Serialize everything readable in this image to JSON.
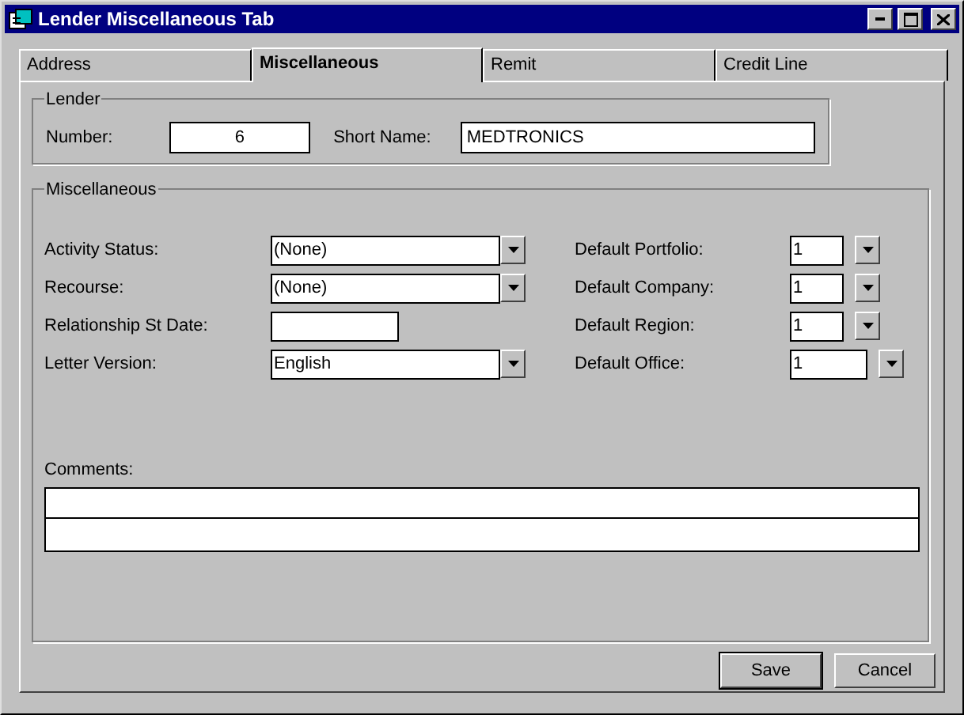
{
  "window": {
    "title": "Lender Miscellaneous Tab"
  },
  "tabs": [
    {
      "label": "Address",
      "selected": false
    },
    {
      "label": "Miscellaneous",
      "selected": true
    },
    {
      "label": "Remit",
      "selected": false
    },
    {
      "label": "Credit Line",
      "selected": false
    }
  ],
  "lender": {
    "title": "Lender",
    "number": {
      "label": "Number:",
      "value": "6"
    },
    "short_name": {
      "label": "Short Name:",
      "value": "MEDTRONICS"
    }
  },
  "miscellaneous": {
    "title": "Miscellaneous",
    "left_fields": [
      {
        "label": "Activity Status:",
        "value": "(None)",
        "kind": "dropdown"
      },
      {
        "label": "Recourse:",
        "value": "(None)",
        "kind": "dropdown"
      },
      {
        "label": "Relationship St Date:",
        "kind": "text"
      },
      {
        "label": "Letter Version:",
        "value": "English",
        "kind": "dropdown"
      }
    ],
    "right_fields": [
      {
        "label": "Default Portfolio:",
        "value": "1",
        "kind": "dropdown"
      },
      {
        "label": "Default Company:",
        "value": "1",
        "kind": "dropdown"
      },
      {
        "label": "Default Region:",
        "value": "1",
        "kind": "dropdown"
      },
      {
        "label": "Default Office:",
        "value": "1",
        "kind": "wide-dropdown"
      }
    ],
    "comments": {
      "label": "Comments:"
    }
  },
  "buttons": [
    {
      "label": "Save",
      "default": true
    },
    {
      "label": "Cancel",
      "default": false
    }
  ]
}
